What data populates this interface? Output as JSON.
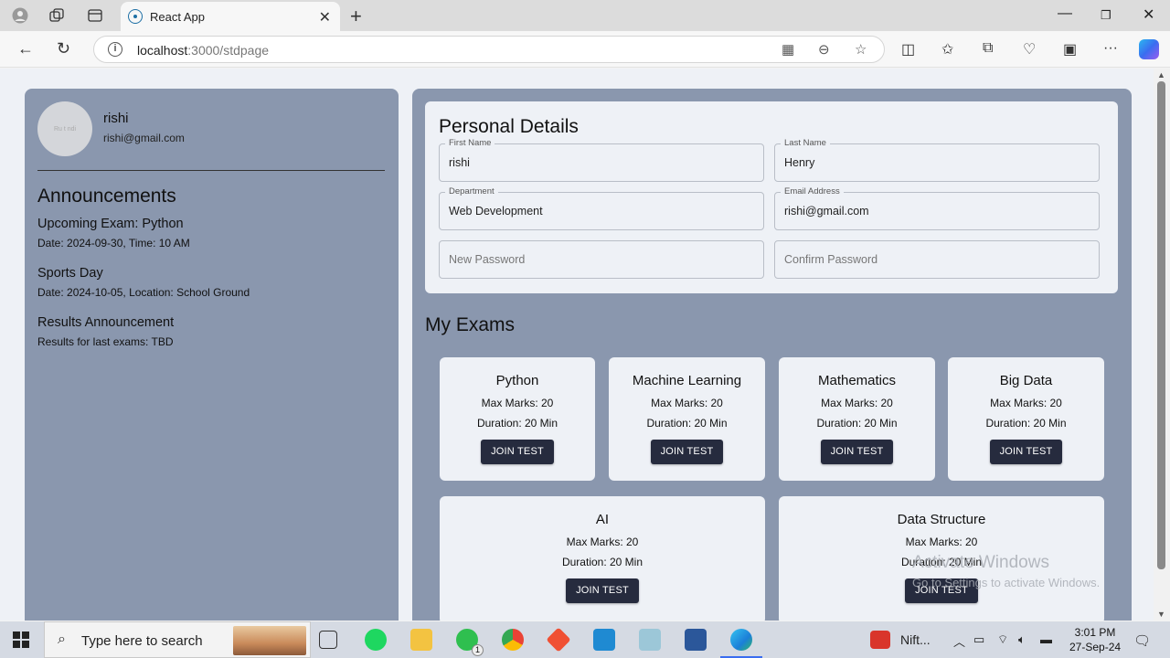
{
  "browser": {
    "tab_title": "React App",
    "url_host": "localhost",
    "url_path": ":3000/stdpage"
  },
  "profile": {
    "avatar_text": "Ru t ndi",
    "name": "rishi",
    "email": "rishi@gmail.com"
  },
  "announcements": {
    "title": "Announcements",
    "items": [
      {
        "heading": "Upcoming Exam: Python",
        "detail": "Date: 2024-09-30, Time: 10 AM"
      },
      {
        "heading": "Sports Day",
        "detail": "Date: 2024-10-05, Location: School Ground"
      },
      {
        "heading": "Results Announcement",
        "detail": "Results for last exams: TBD"
      }
    ]
  },
  "personal_details": {
    "title": "Personal Details",
    "first_name": {
      "label": "First Name",
      "value": "rishi"
    },
    "last_name": {
      "label": "Last Name",
      "value": "Henry"
    },
    "department": {
      "label": "Department",
      "value": "Web Development"
    },
    "email": {
      "label": "Email Address",
      "value": "rishi@gmail.com"
    },
    "new_password": {
      "placeholder": "New Password"
    },
    "confirm_password": {
      "placeholder": "Confirm Password"
    }
  },
  "exams": {
    "title": "My Exams",
    "button_label": "JOIN TEST",
    "items": [
      {
        "name": "Python",
        "max_marks": "Max Marks: 20",
        "duration": "Duration: 20 Min"
      },
      {
        "name": "Machine Learning",
        "max_marks": "Max Marks: 20",
        "duration": "Duration: 20 Min"
      },
      {
        "name": "Mathematics",
        "max_marks": "Max Marks: 20",
        "duration": "Duration: 20 Min"
      },
      {
        "name": "Big Data",
        "max_marks": "Max Marks: 20",
        "duration": "Duration: 20 Min"
      },
      {
        "name": "AI",
        "max_marks": "Max Marks: 20",
        "duration": "Duration: 20 Min"
      },
      {
        "name": "Data Structure",
        "max_marks": "Max Marks: 20",
        "duration": "Duration: 20 Min"
      }
    ]
  },
  "watermark": {
    "line1": "Activate Windows",
    "line2": "Go to Settings to activate Windows."
  },
  "taskbar": {
    "search_placeholder": "Type here to search",
    "nifty_label": "Nift...",
    "whatsapp_badge": "1",
    "time": "3:01 PM",
    "date": "27-Sep-24"
  },
  "colors": {
    "panel": "#8a97ae",
    "card": "#eef1f6",
    "button": "#262b3e"
  }
}
